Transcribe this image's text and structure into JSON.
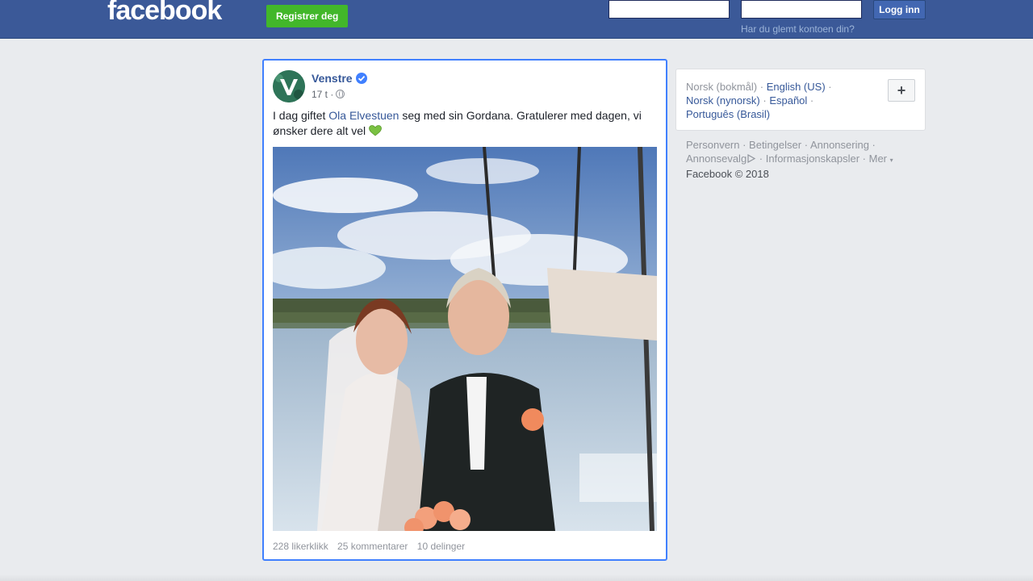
{
  "header": {
    "logo": "facebook",
    "register_label": "Registrer deg",
    "email_value": "",
    "password_value": "",
    "login_label": "Logg inn",
    "forgot_link": "Har du glemt kontoen din?"
  },
  "post": {
    "page_name": "Venstre",
    "time": "17 t ·",
    "text_before": "I dag giftet ",
    "mention": "Ola Elvestuen",
    "text_after": " seg med sin Gordana. Gratulerer med dagen, vi ønsker dere alt vel",
    "likes": "228 likerklikk",
    "comments": "25 kommentarer",
    "shares": "10 delinger"
  },
  "languages": {
    "current": "Norsk (bokmål)",
    "items": [
      "English (US)",
      "Norsk (nynorsk)",
      "Español",
      "Português (Brasil)"
    ],
    "more_button": "+"
  },
  "footer": {
    "links": [
      "Personvern",
      "Betingelser",
      "Annonsering",
      "Annonsevalg",
      "Informasjonskapsler",
      "Mer"
    ],
    "copyright": "Facebook © 2018"
  },
  "colors": {
    "brand": "#3b5998",
    "register_green": "#42b72a",
    "link": "#365899",
    "focus_border": "#4080ff"
  }
}
